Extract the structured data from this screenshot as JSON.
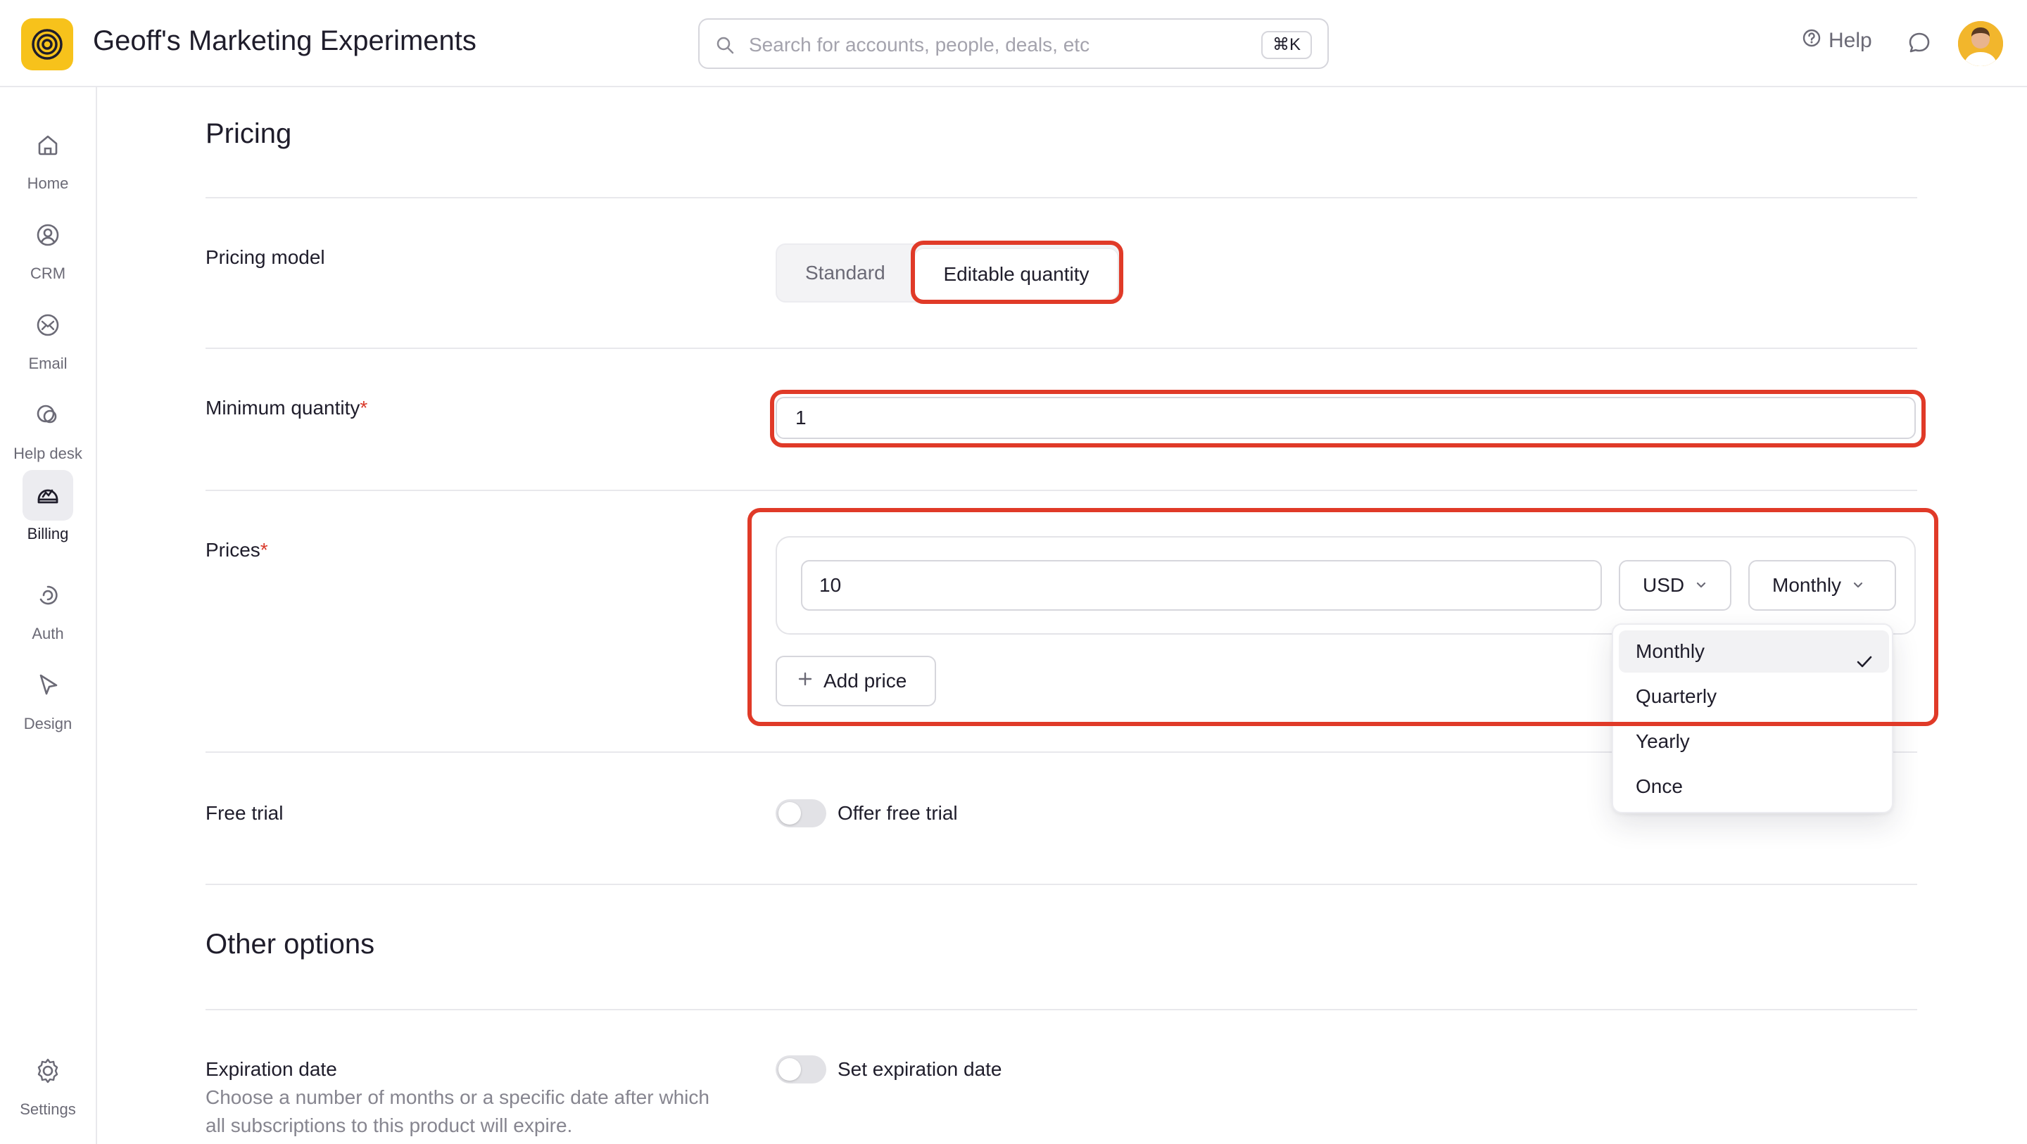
{
  "app": {
    "title": "Geoff's Marketing Experiments",
    "logo_icon": "spiral-logo-icon",
    "accent_color": "#f7c21b"
  },
  "search": {
    "placeholder": "Search for accounts, people, deals, etc",
    "shortcut": "⌘K"
  },
  "header": {
    "help_label": "Help"
  },
  "sidebar": {
    "items": [
      {
        "label": "Home",
        "icon": "home-icon"
      },
      {
        "label": "CRM",
        "icon": "user-circle-icon"
      },
      {
        "label": "Email",
        "icon": "email-icon"
      },
      {
        "label": "Help desk",
        "icon": "help-desk-icon"
      },
      {
        "label": "Billing",
        "icon": "billing-icon",
        "active": true
      },
      {
        "label": "Auth",
        "icon": "auth-icon"
      },
      {
        "label": "Design",
        "icon": "cursor-icon"
      }
    ],
    "settings_label": "Settings"
  },
  "pricing": {
    "heading": "Pricing",
    "model_label": "Pricing model",
    "model_options": [
      "Standard",
      "Editable quantity"
    ],
    "model_selected": "Editable quantity",
    "min_qty_label": "Minimum quantity",
    "min_qty_value": "1",
    "prices_label": "Prices",
    "required_mark": "*",
    "price_value": "10",
    "currency": "USD",
    "period": "Monthly",
    "add_price_label": "Add price",
    "period_options": [
      "Monthly",
      "Quarterly",
      "Yearly",
      "Once"
    ],
    "period_selected": "Monthly",
    "free_trial_label": "Free trial",
    "free_trial_toggle_label": "Offer free trial",
    "free_trial_on": false
  },
  "other": {
    "heading": "Other options",
    "expiration_label": "Expiration date",
    "expiration_desc": "Choose a number of months or a specific date after which all subscriptions to this product will expire.",
    "expiration_toggle_label": "Set expiration date",
    "expiration_on": false
  },
  "annotation_color": "#e03a28"
}
